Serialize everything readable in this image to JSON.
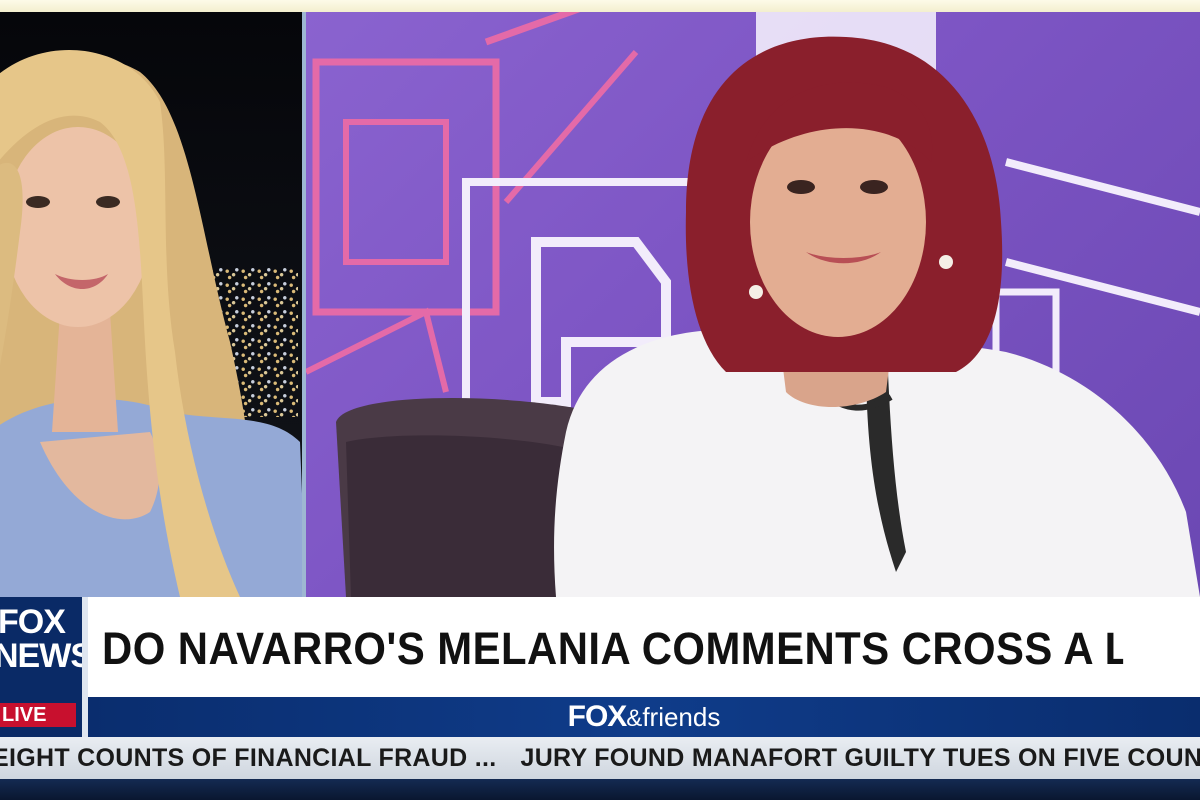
{
  "headline": "DO NAVARRO'S MELANIA COMMENTS CROSS A LINE?",
  "logo": {
    "line1": "FOX",
    "line2": "NEWS",
    "live": "LIVE"
  },
  "show": {
    "brand": "FOX",
    "amp": "&",
    "name": "friends"
  },
  "ticker": {
    "items": [
      "EIGHT COUNTS OF FINANCIAL FRAUD ...",
      "JURY FOUND MANAFORT GUILTY TUES ON FIVE COUNTS OF"
    ]
  },
  "colors": {
    "brand_blue": "#0a2a66",
    "live_red": "#c8102e",
    "stage_purple": "#7d55c4",
    "stage_pink": "#e05aa5"
  }
}
